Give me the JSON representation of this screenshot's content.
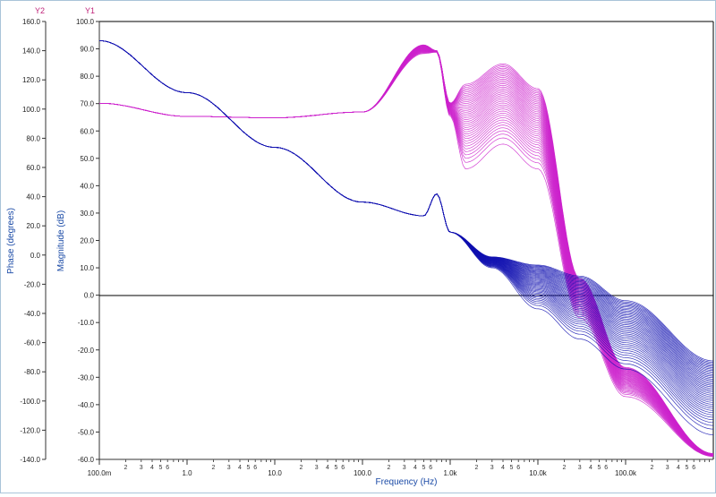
{
  "chart_data": {
    "type": "line",
    "title": "",
    "xlabel": "Frequency (Hz)",
    "x_scale": "log",
    "xlim": [
      0.1,
      1000000
    ],
    "x_tick_labels": [
      "100.0m",
      "1.0",
      "10.0",
      "100.0",
      "1.0k",
      "10.0k",
      "100.0k"
    ],
    "x_minor_labels": [
      "2",
      "3",
      "4",
      "5",
      "6"
    ],
    "y1": {
      "name": "Y1",
      "label": "Magnitude (dB)",
      "color": "#1a1aa6",
      "lim": [
        -60,
        100
      ],
      "tick_labels": [
        "100.0",
        "90.0",
        "80.0",
        "70.0",
        "60.0",
        "50.0",
        "40.0",
        "30.0",
        "20.0",
        "10.0",
        "0.0",
        "-10.0",
        "-20.0",
        "-30.0",
        "-40.0",
        "-50.0",
        "-60.0"
      ]
    },
    "y2": {
      "name": "Y2",
      "label": "Phase (degrees)",
      "color": "#c0247a",
      "lim": [
        -140,
        160
      ],
      "tick_labels": [
        "160.0",
        "140.0",
        "120.0",
        "100.0",
        "80.0",
        "60.0",
        "40.0",
        "20.0",
        "0.0",
        "-20.0",
        "-40.0",
        "-60.0",
        "-80.0",
        "-100.0",
        "-120.0",
        "-140.0"
      ]
    },
    "magnitude_color": "#1010b0",
    "phase_color": "#cc22cc",
    "n_curves": 40,
    "series": [
      {
        "kind": "magnitude_envelope_low",
        "x": [
          0.1,
          1,
          10,
          100,
          500,
          700,
          1000,
          3000,
          10000,
          30000,
          100000,
          1000000
        ],
        "y": [
          93,
          74,
          54,
          34,
          29,
          37,
          23,
          10,
          -5,
          -16,
          -27,
          -51
        ]
      },
      {
        "kind": "magnitude_envelope_high",
        "x": [
          0.1,
          1,
          10,
          100,
          500,
          700,
          1000,
          3000,
          10000,
          30000,
          100000,
          1000000
        ],
        "y": [
          93,
          74,
          54,
          34,
          29,
          37,
          23,
          14,
          11,
          7,
          -2,
          -24
        ]
      },
      {
        "kind": "phase_envelope_low",
        "x": [
          0.1,
          1,
          10,
          100,
          500,
          700,
          1000,
          1500,
          4000,
          10000,
          30000,
          100000,
          1000000
        ],
        "y": [
          104,
          95,
          94,
          98,
          138,
          139,
          95,
          59,
          76,
          59,
          -43,
          -97,
          -138
        ]
      },
      {
        "kind": "phase_envelope_high",
        "x": [
          0.1,
          1,
          10,
          100,
          500,
          700,
          1000,
          1500,
          4000,
          10000,
          30000,
          100000,
          1000000
        ],
        "y": [
          104,
          95,
          94,
          98,
          144,
          140,
          104,
          117,
          131,
          114,
          -16,
          -77,
          -136
        ]
      }
    ],
    "grid": false,
    "zero_line": true
  }
}
